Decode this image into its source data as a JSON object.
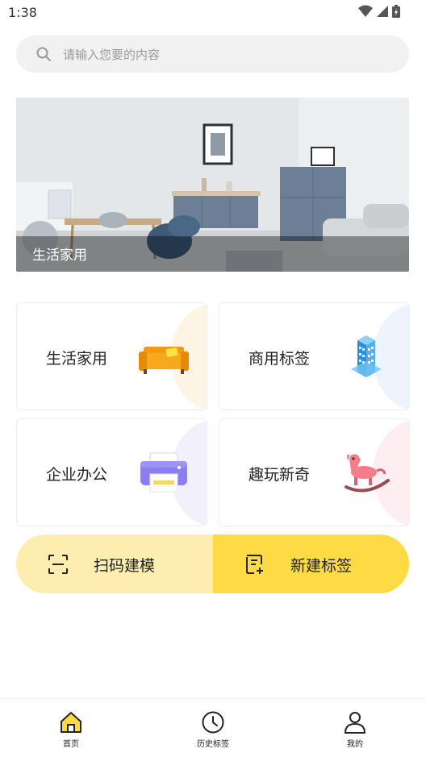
{
  "status": {
    "time": "1:38"
  },
  "search": {
    "placeholder": "请输入您要的内容"
  },
  "banner": {
    "caption": "生活家用"
  },
  "categories": [
    {
      "label": "生活家用",
      "icon": "sofa-icon",
      "deco_color": "#fdf4e3"
    },
    {
      "label": "商用标签",
      "icon": "building-icon",
      "deco_color": "#eef4fd"
    },
    {
      "label": "企业办公",
      "icon": "printer-icon",
      "deco_color": "#f1f0fb"
    },
    {
      "label": "趣玩新奇",
      "icon": "rocking-horse-icon",
      "deco_color": "#fdeef1"
    }
  ],
  "actions": {
    "scan": {
      "label": "扫码建模",
      "icon": "scan-icon",
      "color": "#fdeeb0"
    },
    "new": {
      "label": "新建标签",
      "icon": "new-label-icon",
      "color": "#fedb45"
    }
  },
  "tabs": [
    {
      "label": "首页",
      "icon": "home-icon",
      "active": true
    },
    {
      "label": "历史标签",
      "icon": "clock-icon",
      "active": false
    },
    {
      "label": "我的",
      "icon": "user-icon",
      "active": false
    }
  ],
  "colors": {
    "accent": "#fedb45",
    "accent_light": "#fdeeb0"
  }
}
